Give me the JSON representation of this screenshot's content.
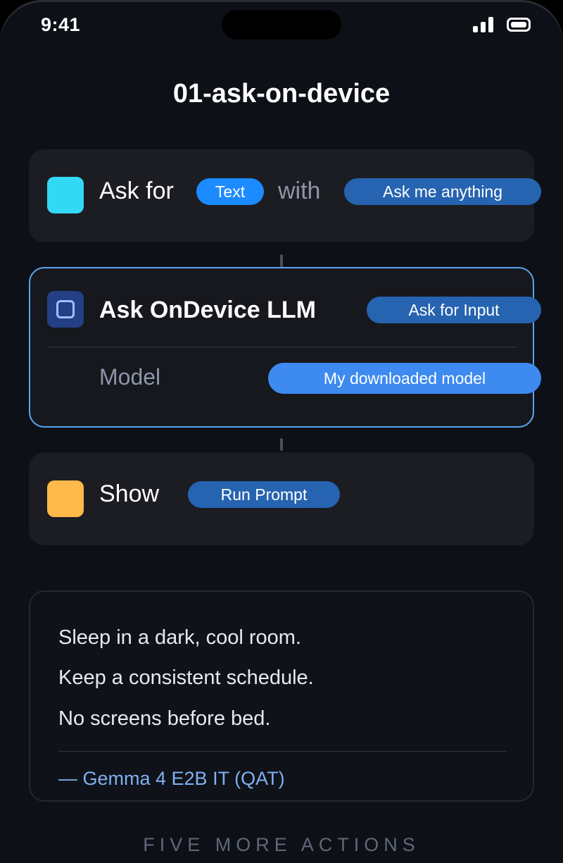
{
  "status": {
    "time": "9:41"
  },
  "workflow_title": "01-ask-on-device",
  "steps": [
    {
      "label": "Ask for",
      "type_pill": "Text",
      "connector_word": "with",
      "prompt_pill": "Ask me anything",
      "color": "#33d8f5"
    },
    {
      "label": "Ask OnDevice LLM",
      "input_pill": "Ask for Input",
      "param_label": "Model",
      "param_value": "My downloaded model",
      "selected": true
    },
    {
      "label": "Show",
      "value_pill": "Run Prompt",
      "color": "#ffb84a"
    }
  ],
  "output": {
    "lines": [
      "Sleep in a dark, cool room.",
      "Keep a consistent schedule.",
      "No screens before bed."
    ],
    "attribution": "— Gemma 4 E2B IT (QAT)"
  },
  "footer": "FIVE MORE ACTIONS",
  "colors": {
    "accent_blue": "#1b8bff",
    "pill_blue": "#2663b0",
    "selected_border": "#5aa5f0",
    "attribution": "#7fb0f2"
  }
}
